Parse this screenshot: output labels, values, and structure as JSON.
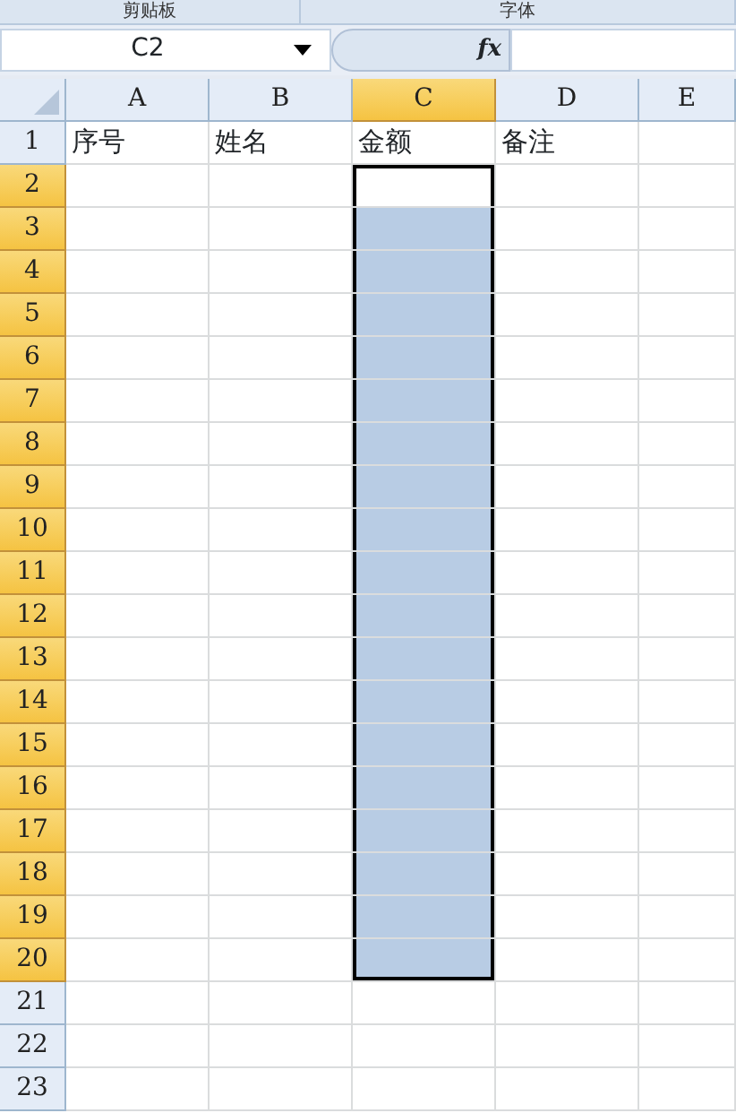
{
  "ribbon_groups": [
    "剪贴板",
    "字体"
  ],
  "formula_bar": {
    "name_box": "C2",
    "function_button": "fx"
  },
  "columns": [
    {
      "label": "A",
      "selected": false
    },
    {
      "label": "B",
      "selected": false
    },
    {
      "label": "C",
      "selected": true
    },
    {
      "label": "D",
      "selected": false
    },
    {
      "label": "E",
      "selected": false
    }
  ],
  "rows": [
    {
      "number": "1",
      "selected": false,
      "cells": [
        "序号",
        "姓名",
        "金额",
        "备注"
      ]
    },
    {
      "number": "2",
      "selected": true
    },
    {
      "number": "3",
      "selected": true
    },
    {
      "number": "4",
      "selected": true
    },
    {
      "number": "5",
      "selected": true
    },
    {
      "number": "6",
      "selected": true
    },
    {
      "number": "7",
      "selected": true
    },
    {
      "number": "8",
      "selected": true
    },
    {
      "number": "9",
      "selected": true
    },
    {
      "number": "10",
      "selected": true
    },
    {
      "number": "11",
      "selected": true
    },
    {
      "number": "12",
      "selected": true
    },
    {
      "number": "13",
      "selected": true
    },
    {
      "number": "14",
      "selected": true
    },
    {
      "number": "15",
      "selected": true
    },
    {
      "number": "16",
      "selected": true
    },
    {
      "number": "17",
      "selected": true
    },
    {
      "number": "18",
      "selected": true
    },
    {
      "number": "19",
      "selected": true
    },
    {
      "number": "20",
      "selected": true
    },
    {
      "number": "21",
      "selected": false
    },
    {
      "number": "22",
      "selected": false
    },
    {
      "number": "23",
      "selected": false
    }
  ]
}
